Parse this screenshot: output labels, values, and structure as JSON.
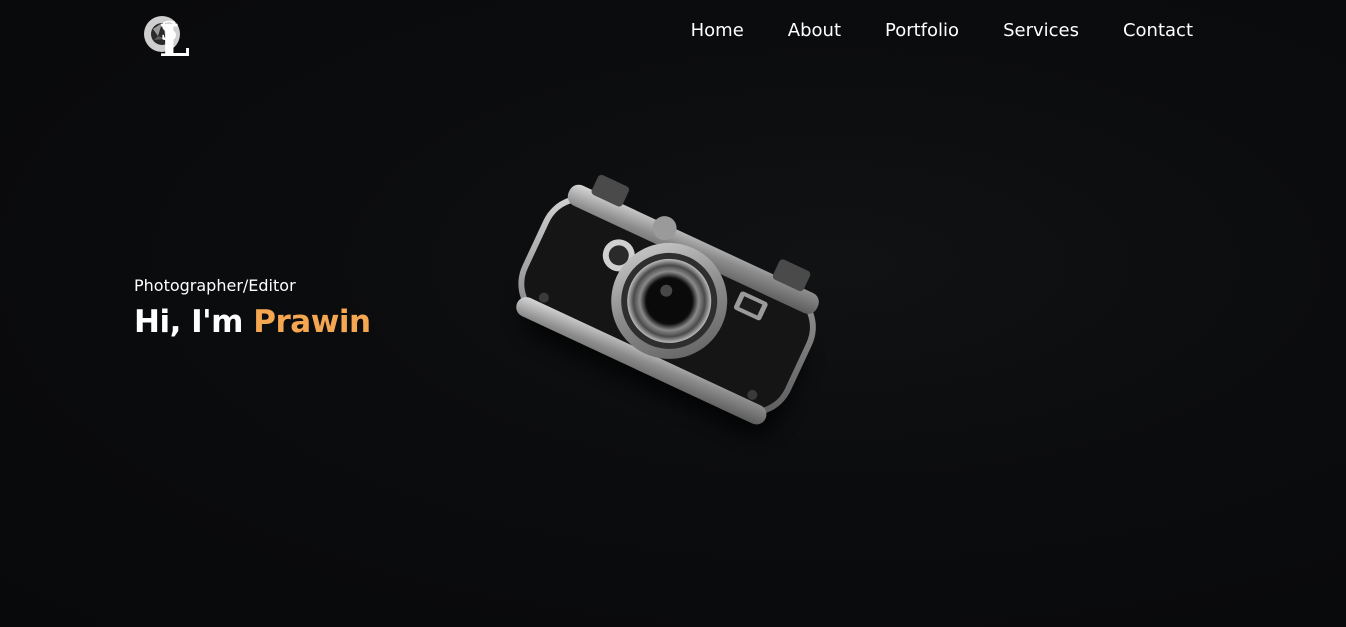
{
  "logo": {
    "letters": "LS",
    "icon": "aperture-logo-icon"
  },
  "nav": {
    "items": [
      {
        "label": "Home"
      },
      {
        "label": "About"
      },
      {
        "label": "Portfolio"
      },
      {
        "label": "Services"
      },
      {
        "label": "Contact"
      }
    ]
  },
  "hero": {
    "subtitle": "Photographer/Editor",
    "greeting": "Hi, I'm",
    "name": "Prawin",
    "accent_color": "#f5a651",
    "image": "vintage-camera-photo"
  }
}
